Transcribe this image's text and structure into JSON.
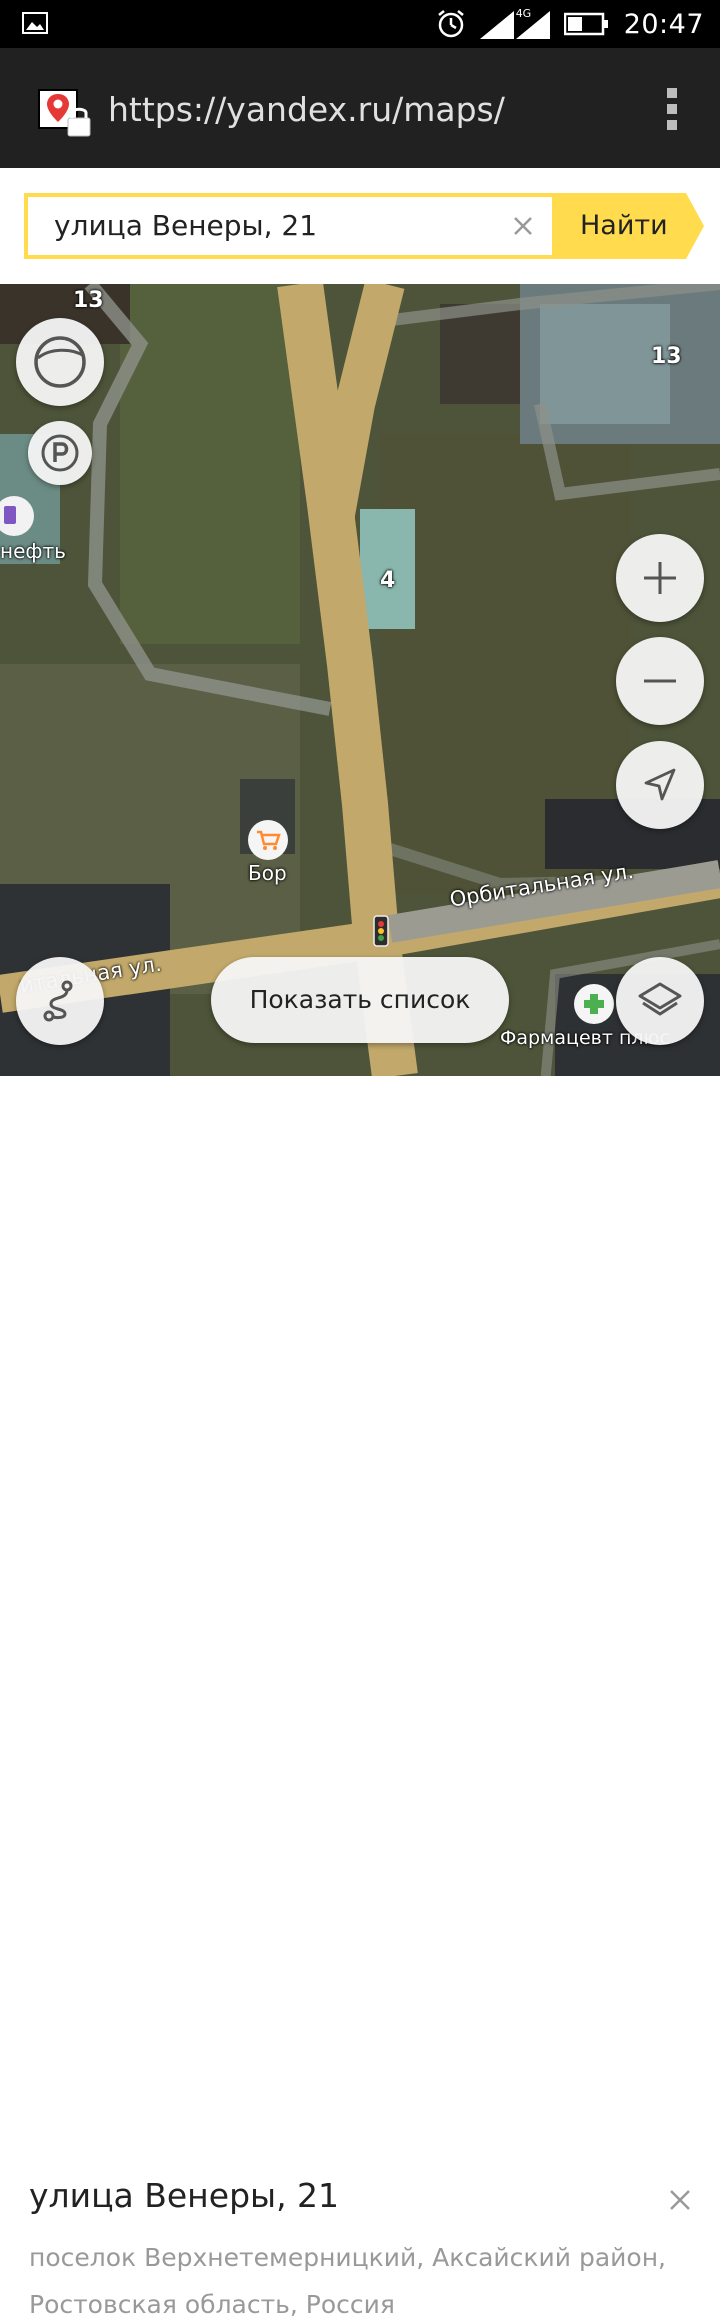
{
  "status_bar": {
    "time": "20:47",
    "network": "4G",
    "icons": [
      "image-icon",
      "alarm-icon",
      "signal-icon",
      "battery-icon"
    ]
  },
  "browser": {
    "url": "https://yandex.ru/maps/",
    "favicon": "yandex-maps-pin-lock-icon",
    "menu_icon": "overflow-menu-icon"
  },
  "search": {
    "query": "улица Венеры, 21",
    "clear_icon": "close-icon",
    "button_label": "Найти",
    "accent_color": "#ffdb4d"
  },
  "map": {
    "labels": {
      "house_13_left": "13",
      "house_13_right": "13",
      "house_4": "4",
      "gas_station": "нефть",
      "shop": "Бор",
      "street_orbital": "Орбитальная ул.",
      "street_left": "итальная ул.",
      "pharmacy": "Фармацевт плюс"
    },
    "controls": {
      "panorama": "panorama-icon",
      "parking": "parking-icon",
      "zoom_in": "plus-icon",
      "zoom_out": "minus-icon",
      "locate": "navigation-arrow-icon",
      "route": "route-icon",
      "layers": "layers-icon"
    },
    "show_list_label": "Показать список"
  },
  "result_card": {
    "title": "улица Венеры, 21",
    "address_line1": "поселок Верхнетемерницкий, Аксайский район,",
    "address_line2": "Ростовская область, Россия"
  }
}
